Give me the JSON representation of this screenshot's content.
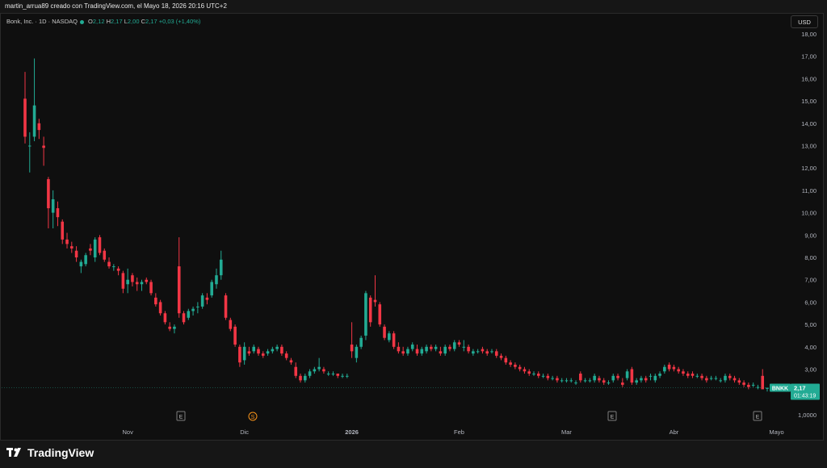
{
  "header": {
    "credit": "martin_arrua89 creado con TradingView.com, el Mayo 18, 2026 20:16 UTC+2"
  },
  "legend": {
    "symbol": "Bonk, Inc. · 1D · NASDAQ",
    "o_label": "O",
    "o_value": "2,12",
    "h_label": "H",
    "h_value": "2,17",
    "l_label": "L",
    "l_value": "2,00",
    "c_label": "C",
    "c_value": "2,17",
    "change": "+0,03 (+1,40%)"
  },
  "currency_button": "USD",
  "footer": {
    "brand": "TradingView",
    "logo": "tradingview-logo-icon"
  },
  "colors": {
    "up": "#22ab94",
    "down": "#f23645",
    "background": "#0f0f0f",
    "axis_text": "#b2b5be"
  },
  "chart_data": {
    "type": "candlestick",
    "y_axis": {
      "ticks": [
        "18,00",
        "17,00",
        "16,00",
        "15,00",
        "14,00",
        "13,00",
        "12,00",
        "11,00",
        "10,00",
        "9,00",
        "8,00",
        "7,00",
        "6,00",
        "5,00",
        "4,00",
        "3,00",
        "1,0000"
      ],
      "ylim": [
        2.0,
        18.0
      ]
    },
    "x_axis": {
      "ticks": [
        "Nov",
        "Dic",
        "2026",
        "Feb",
        "Mar",
        "Abr",
        "Mayo"
      ]
    },
    "last_price": {
      "symbol": "BNKK",
      "value": "2,17",
      "countdown": "01:43:19"
    },
    "event_markers": [
      {
        "label": "E",
        "date": "Nov 18"
      },
      {
        "label": "S",
        "date": "Dic 12"
      },
      {
        "label": "E",
        "date": "Mar 31"
      },
      {
        "label": "E",
        "date": "May 15"
      }
    ],
    "candles": [
      [
        15.1,
        16.3,
        13.1,
        13.4
      ],
      [
        13.0,
        13.6,
        11.8,
        13.0
      ],
      [
        13.4,
        16.9,
        13.2,
        14.8
      ],
      [
        14.0,
        14.2,
        13.3,
        13.7
      ],
      [
        13.0,
        13.4,
        12.1,
        12.9
      ],
      [
        11.5,
        11.6,
        9.3,
        10.2
      ],
      [
        10.0,
        11.0,
        9.3,
        10.6
      ],
      [
        10.2,
        10.5,
        9.4,
        9.8
      ],
      [
        9.6,
        9.7,
        8.6,
        8.8
      ],
      [
        8.8,
        9.1,
        8.4,
        8.6
      ],
      [
        8.5,
        8.7,
        8.2,
        8.4
      ],
      [
        8.3,
        8.5,
        7.8,
        8.0
      ],
      [
        7.6,
        7.9,
        7.3,
        7.8
      ],
      [
        7.7,
        8.2,
        7.6,
        8.1
      ],
      [
        8.4,
        8.6,
        8.1,
        8.3
      ],
      [
        8.0,
        8.9,
        7.8,
        8.8
      ],
      [
        8.9,
        9.0,
        8.1,
        8.2
      ],
      [
        8.3,
        8.4,
        7.8,
        7.9
      ],
      [
        7.8,
        8.0,
        7.5,
        7.6
      ],
      [
        7.6,
        7.7,
        7.4,
        7.6
      ],
      [
        7.5,
        7.6,
        7.2,
        7.4
      ],
      [
        7.3,
        7.4,
        6.4,
        6.6
      ],
      [
        6.8,
        7.5,
        6.4,
        7.0
      ],
      [
        7.2,
        7.3,
        6.7,
        6.9
      ],
      [
        6.9,
        7.1,
        6.5,
        6.8
      ],
      [
        6.8,
        7.0,
        6.5,
        6.9
      ],
      [
        7.0,
        7.1,
        6.8,
        6.9
      ],
      [
        6.9,
        7.0,
        6.3,
        6.4
      ],
      [
        6.2,
        6.4,
        5.8,
        5.9
      ],
      [
        6.0,
        6.1,
        5.4,
        5.5
      ],
      [
        5.5,
        5.6,
        5.0,
        5.1
      ],
      [
        4.9,
        5.1,
        4.7,
        4.8
      ],
      [
        4.8,
        5.0,
        4.6,
        4.9
      ],
      [
        7.6,
        8.9,
        5.3,
        5.5
      ],
      [
        5.5,
        5.6,
        5.0,
        5.1
      ],
      [
        5.3,
        5.7,
        5.2,
        5.6
      ],
      [
        5.6,
        5.8,
        5.4,
        5.7
      ],
      [
        5.8,
        6.0,
        5.5,
        5.8
      ],
      [
        5.8,
        6.4,
        5.7,
        6.3
      ],
      [
        6.2,
        6.4,
        5.9,
        6.1
      ],
      [
        6.3,
        7.0,
        6.2,
        6.9
      ],
      [
        6.8,
        7.5,
        6.6,
        7.2
      ],
      [
        7.2,
        8.3,
        7.0,
        7.9
      ],
      [
        6.3,
        6.4,
        5.2,
        5.3
      ],
      [
        5.2,
        5.3,
        4.7,
        4.8
      ],
      [
        4.9,
        5.0,
        4.0,
        4.1
      ],
      [
        4.0,
        4.1,
        3.1,
        3.3
      ],
      [
        3.4,
        4.2,
        3.2,
        4.0
      ],
      [
        3.8,
        4.0,
        3.6,
        3.7
      ],
      [
        3.8,
        4.1,
        3.7,
        4.0
      ],
      [
        3.9,
        4.0,
        3.6,
        3.7
      ],
      [
        3.7,
        3.8,
        3.5,
        3.6
      ],
      [
        3.7,
        3.9,
        3.6,
        3.8
      ],
      [
        3.8,
        4.0,
        3.7,
        3.9
      ],
      [
        3.9,
        4.1,
        3.8,
        4.0
      ],
      [
        4.0,
        4.1,
        3.6,
        3.7
      ],
      [
        3.7,
        3.8,
        3.4,
        3.5
      ],
      [
        3.4,
        3.5,
        3.2,
        3.3
      ],
      [
        3.1,
        3.3,
        2.6,
        2.7
      ],
      [
        2.7,
        2.8,
        2.4,
        2.5
      ],
      [
        2.5,
        2.8,
        2.4,
        2.7
      ],
      [
        2.7,
        3.0,
        2.6,
        2.9
      ],
      [
        2.9,
        3.1,
        2.8,
        3.0
      ],
      [
        3.0,
        3.5,
        2.9,
        3.1
      ],
      [
        3.0,
        3.1,
        2.8,
        2.9
      ],
      [
        2.8,
        2.9,
        2.7,
        2.8
      ],
      [
        2.8,
        2.9,
        2.7,
        2.8
      ],
      [
        2.8,
        2.8,
        2.6,
        2.7
      ],
      [
        2.7,
        2.8,
        2.6,
        2.7
      ],
      [
        2.7,
        2.8,
        2.6,
        2.7
      ],
      [
        4.1,
        5.1,
        3.5,
        3.8
      ],
      [
        3.5,
        4.1,
        3.3,
        4.0
      ],
      [
        4.0,
        4.5,
        3.9,
        4.4
      ],
      [
        4.5,
        6.5,
        4.3,
        6.4
      ],
      [
        6.2,
        6.3,
        4.9,
        5.1
      ],
      [
        6.1,
        7.2,
        5.8,
        6.0
      ],
      [
        5.9,
        6.0,
        4.9,
        5.0
      ],
      [
        4.9,
        5.0,
        4.3,
        4.4
      ],
      [
        4.3,
        4.7,
        4.2,
        4.6
      ],
      [
        4.6,
        4.7,
        3.9,
        4.0
      ],
      [
        4.0,
        4.2,
        3.7,
        3.8
      ],
      [
        3.8,
        4.0,
        3.6,
        3.7
      ],
      [
        3.7,
        4.0,
        3.6,
        3.9
      ],
      [
        3.9,
        4.2,
        3.8,
        4.1
      ],
      [
        3.9,
        4.1,
        3.6,
        3.7
      ],
      [
        3.7,
        4.0,
        3.6,
        3.9
      ],
      [
        3.8,
        4.1,
        3.7,
        4.0
      ],
      [
        4.0,
        4.1,
        3.8,
        3.9
      ],
      [
        3.9,
        4.1,
        3.8,
        4.0
      ],
      [
        3.8,
        4.0,
        3.6,
        3.7
      ],
      [
        3.7,
        4.1,
        3.6,
        4.0
      ],
      [
        4.0,
        4.1,
        3.8,
        3.9
      ],
      [
        3.9,
        4.3,
        3.8,
        4.2
      ],
      [
        4.2,
        4.3,
        4.0,
        4.1
      ],
      [
        4.0,
        4.3,
        3.8,
        4.0
      ],
      [
        4.0,
        4.1,
        3.7,
        3.8
      ],
      [
        3.7,
        3.9,
        3.6,
        3.8
      ],
      [
        3.8,
        3.9,
        3.7,
        3.8
      ],
      [
        3.9,
        4.0,
        3.7,
        3.8
      ],
      [
        3.8,
        3.9,
        3.6,
        3.7
      ],
      [
        3.8,
        3.9,
        3.7,
        3.8
      ],
      [
        3.8,
        3.9,
        3.5,
        3.6
      ],
      [
        3.6,
        3.7,
        3.4,
        3.5
      ],
      [
        3.5,
        3.6,
        3.2,
        3.3
      ],
      [
        3.3,
        3.4,
        3.1,
        3.2
      ],
      [
        3.2,
        3.3,
        3.0,
        3.1
      ],
      [
        3.1,
        3.2,
        2.9,
        3.0
      ],
      [
        3.0,
        3.1,
        2.8,
        2.9
      ],
      [
        2.9,
        3.0,
        2.7,
        2.8
      ],
      [
        2.8,
        2.9,
        2.7,
        2.8
      ],
      [
        2.8,
        2.9,
        2.6,
        2.7
      ],
      [
        2.7,
        2.8,
        2.6,
        2.7
      ],
      [
        2.7,
        2.8,
        2.5,
        2.6
      ],
      [
        2.6,
        2.7,
        2.5,
        2.6
      ],
      [
        2.6,
        2.7,
        2.4,
        2.5
      ],
      [
        2.5,
        2.6,
        2.4,
        2.5
      ],
      [
        2.5,
        2.6,
        2.4,
        2.5
      ],
      [
        2.5,
        2.6,
        2.4,
        2.5
      ],
      [
        2.4,
        2.5,
        2.3,
        2.4
      ],
      [
        2.8,
        2.9,
        2.4,
        2.5
      ],
      [
        2.5,
        2.6,
        2.4,
        2.5
      ],
      [
        2.5,
        2.6,
        2.4,
        2.5
      ],
      [
        2.5,
        2.8,
        2.4,
        2.7
      ],
      [
        2.6,
        2.7,
        2.4,
        2.5
      ],
      [
        2.5,
        2.6,
        2.3,
        2.4
      ],
      [
        2.4,
        2.5,
        2.3,
        2.4
      ],
      [
        2.5,
        2.8,
        2.4,
        2.7
      ],
      [
        2.7,
        2.8,
        2.5,
        2.6
      ],
      [
        2.4,
        2.6,
        2.2,
        2.3
      ],
      [
        2.6,
        3.0,
        2.5,
        2.9
      ],
      [
        3.0,
        3.1,
        2.3,
        2.4
      ],
      [
        2.4,
        2.6,
        2.3,
        2.5
      ],
      [
        2.5,
        2.7,
        2.4,
        2.6
      ],
      [
        2.6,
        2.7,
        2.4,
        2.5
      ],
      [
        2.7,
        2.8,
        2.5,
        2.7
      ],
      [
        2.5,
        2.8,
        2.4,
        2.7
      ],
      [
        2.7,
        2.9,
        2.6,
        2.8
      ],
      [
        2.9,
        3.2,
        2.8,
        3.1
      ],
      [
        3.2,
        3.3,
        2.9,
        3.0
      ],
      [
        3.1,
        3.2,
        2.9,
        3.0
      ],
      [
        3.0,
        3.1,
        2.8,
        2.9
      ],
      [
        2.9,
        3.0,
        2.7,
        2.8
      ],
      [
        2.8,
        2.9,
        2.6,
        2.7
      ],
      [
        2.8,
        2.9,
        2.6,
        2.7
      ],
      [
        2.7,
        2.8,
        2.6,
        2.7
      ],
      [
        2.7,
        2.8,
        2.5,
        2.6
      ],
      [
        2.6,
        2.7,
        2.4,
        2.5
      ],
      [
        2.6,
        2.7,
        2.5,
        2.6
      ],
      [
        2.6,
        2.7,
        2.5,
        2.6
      ],
      [
        2.5,
        2.6,
        2.4,
        2.5
      ],
      [
        2.5,
        2.8,
        2.4,
        2.7
      ],
      [
        2.7,
        2.8,
        2.5,
        2.6
      ],
      [
        2.6,
        2.7,
        2.4,
        2.5
      ],
      [
        2.5,
        2.6,
        2.3,
        2.4
      ],
      [
        2.4,
        2.5,
        2.2,
        2.3
      ],
      [
        2.3,
        2.4,
        2.1,
        2.2
      ],
      [
        2.3,
        2.4,
        2.2,
        2.3
      ],
      [
        2.2,
        2.3,
        2.1,
        2.2
      ],
      [
        2.7,
        3.0,
        2.1,
        2.1
      ],
      [
        2.12,
        2.17,
        2.0,
        2.17
      ]
    ]
  }
}
